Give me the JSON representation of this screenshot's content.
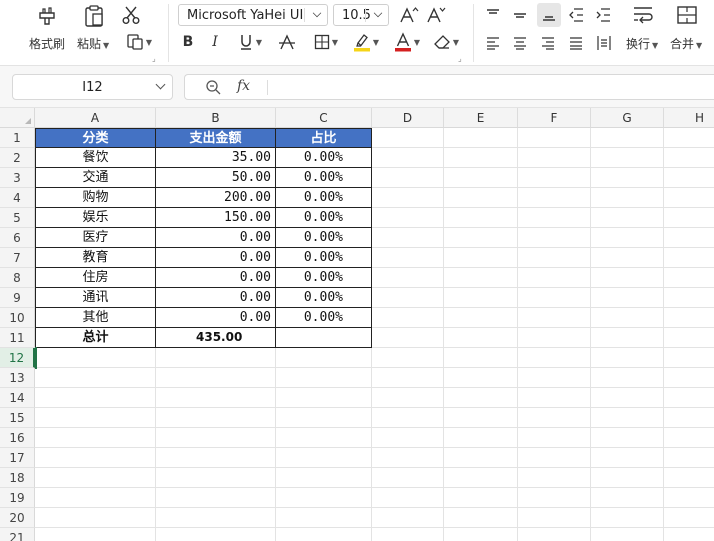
{
  "ribbon": {
    "format_painter_label": "格式刷",
    "paste_label": "粘贴",
    "font_name": "Microsoft YaHei UI",
    "font_size": "10.5",
    "wrap_label": "换行",
    "merge_label": "合并"
  },
  "formula_bar": {
    "name_box": "I12",
    "fx_label": "fx",
    "formula": ""
  },
  "columns": [
    "A",
    "B",
    "C",
    "D",
    "E",
    "F",
    "G",
    "H"
  ],
  "rows": [
    "1",
    "2",
    "3",
    "4",
    "5",
    "6",
    "7",
    "8",
    "9",
    "10",
    "11",
    "12",
    "13",
    "14",
    "15",
    "16",
    "17",
    "18",
    "19",
    "20",
    "21"
  ],
  "table": {
    "headers": [
      "分类",
      "支出金额",
      "占比"
    ],
    "rows": [
      {
        "category": "餐饮",
        "amount": "35.00",
        "ratio": "0.00%"
      },
      {
        "category": "交通",
        "amount": "50.00",
        "ratio": "0.00%"
      },
      {
        "category": "购物",
        "amount": "200.00",
        "ratio": "0.00%"
      },
      {
        "category": "娱乐",
        "amount": "150.00",
        "ratio": "0.00%"
      },
      {
        "category": "医疗",
        "amount": "0.00",
        "ratio": "0.00%"
      },
      {
        "category": "教育",
        "amount": "0.00",
        "ratio": "0.00%"
      },
      {
        "category": "住房",
        "amount": "0.00",
        "ratio": "0.00%"
      },
      {
        "category": "通讯",
        "amount": "0.00",
        "ratio": "0.00%"
      },
      {
        "category": "其他",
        "amount": "0.00",
        "ratio": "0.00%"
      }
    ],
    "total": {
      "label": "总计",
      "amount": "435.00",
      "ratio": ""
    }
  },
  "colors": {
    "header_fill": "#4472c4",
    "header_text": "#ffffff",
    "selection": "#217346",
    "highlight_bar": "#f5d418",
    "font_color_bar": "#d42020"
  },
  "icons": [
    "format-painter-icon",
    "paste-icon",
    "cut-icon",
    "copy-format-icon",
    "bold-icon",
    "italic-icon",
    "underline-icon",
    "strikethrough-icon",
    "border-icon",
    "highlight-icon",
    "font-color-icon",
    "eraser-icon",
    "increase-font-icon",
    "decrease-font-icon",
    "align-top-icon",
    "align-middle-icon",
    "align-bottom-icon",
    "indent-decrease-icon",
    "indent-increase-icon",
    "wrap-text-icon",
    "merge-icon",
    "align-left-icon",
    "align-center-icon",
    "align-right-icon",
    "justify-icon",
    "distribute-icon",
    "zoom-icon"
  ]
}
